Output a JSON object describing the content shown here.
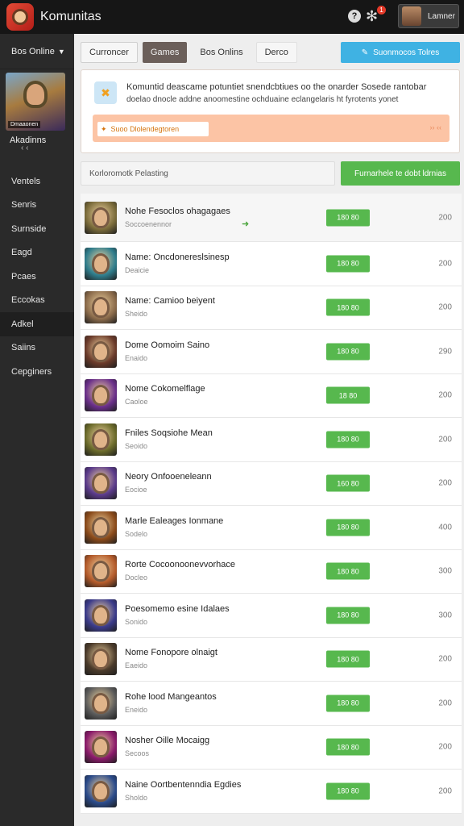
{
  "app": {
    "title": "Komunitas",
    "user_name": "Lamner",
    "notif_count": "1"
  },
  "sidebar": {
    "dropdown": "Bos Online",
    "banner_caption": "Dmaaonen",
    "subtitle": "Akadinns",
    "mini": "‹ ‹",
    "items": [
      {
        "label": "Ventels"
      },
      {
        "label": "Senris"
      },
      {
        "label": "Surnside"
      },
      {
        "label": "Eagd"
      },
      {
        "label": "Pcaes"
      },
      {
        "label": "Eccokas"
      },
      {
        "label": "Adkel"
      },
      {
        "label": "Saiins"
      },
      {
        "label": "Cepginers"
      }
    ]
  },
  "tabs": [
    {
      "label": "Curroncer"
    },
    {
      "label": "Games"
    },
    {
      "label": "Bos Onlins"
    },
    {
      "label": "Derco"
    }
  ],
  "subscribe": {
    "label": "Suonmocos Tolres"
  },
  "info": {
    "line1": "Komuntid deascame potuntiet snendcbtiues oo the onarder Sosede rantobar",
    "line2": "doelao dnocle addne anoomestine ochduaine eclangelaris ht fyrotents yonet",
    "promo_placeholder": "Suoo Dlolendegtoren",
    "promo_note": "›› ‹‹"
  },
  "search": {
    "placeholder": "Korloromotk Pelasting",
    "button": "Furnarhele te dobt ldrnias"
  },
  "colors": {
    "accent_green": "#57b84e",
    "accent_blue": "#3fb2e3",
    "topbar": "#161616",
    "sidebar": "#2a2a2a"
  },
  "rows": [
    {
      "title": "Nohe Fesoclos ohagagaes",
      "sub": "Soccoenennor",
      "price": "180 80",
      "count": "200",
      "art": "#7a6b3a"
    },
    {
      "title": "Name: Oncdonereslsinesp",
      "sub": "Deaicie",
      "price": "180 80",
      "count": "200",
      "art": "#2f7d8c"
    },
    {
      "title": "Name: Camioo beiyent",
      "sub": "Sheido",
      "price": "180 80",
      "count": "200",
      "art": "#8a6a4a"
    },
    {
      "title": "Dome Oomoim Saino",
      "sub": "Enaido",
      "price": "180 80",
      "count": "290",
      "art": "#6a3a2a"
    },
    {
      "title": "Nome Cokomelflage",
      "sub": "Caoloe",
      "price": "18 80",
      "count": "200",
      "art": "#6a2f8a"
    },
    {
      "title": "Fniles Soqsiohe Mean",
      "sub": "Seoido",
      "price": "180 80",
      "count": "200",
      "art": "#6a6a2a"
    },
    {
      "title": "Neory Onfooeneleann",
      "sub": "Eocioe",
      "price": "160 80",
      "count": "200",
      "art": "#5a3a8a"
    },
    {
      "title": "Marle Ealeages Ionmane",
      "sub": "Sodelo",
      "price": "180 80",
      "count": "400",
      "art": "#8a4a1a"
    },
    {
      "title": "Rorte Cocoonoonevvorhace",
      "sub": "Docleo",
      "price": "180 80",
      "count": "300",
      "art": "#b35a2a"
    },
    {
      "title": "Poesomemo esine Idalaes",
      "sub": "Sonido",
      "price": "180 80",
      "count": "300",
      "art": "#3a3a8a"
    },
    {
      "title": "Nome Fonopore olnaigt",
      "sub": "Eaeido",
      "price": "180 80",
      "count": "200",
      "art": "#4a3a2a"
    },
    {
      "title": "Rohe lood Mangeantos",
      "sub": "Eneido",
      "price": "180 80",
      "count": "200",
      "art": "#5a5a5a"
    },
    {
      "title": "Nosher Oille Mocaigg",
      "sub": "Secoos",
      "price": "180 80",
      "count": "200",
      "art": "#8a1a6a"
    },
    {
      "title": "Naine Oortbentenndia Egdies",
      "sub": "Sholdo",
      "price": "180 80",
      "count": "200",
      "art": "#2a4a8a"
    }
  ]
}
